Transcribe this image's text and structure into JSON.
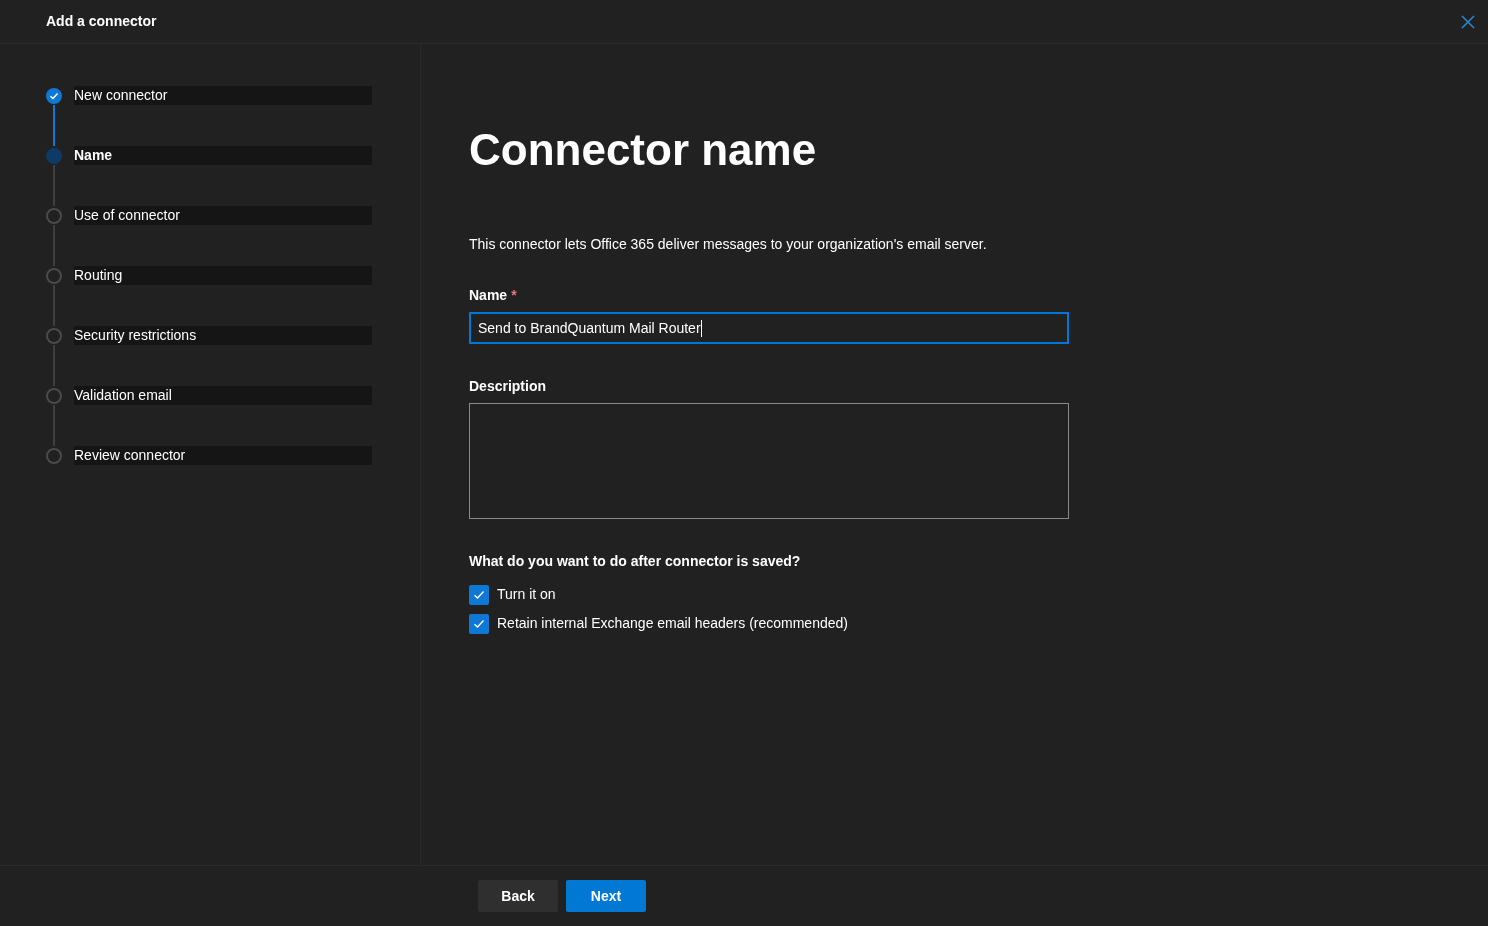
{
  "window": {
    "title": "Add a connector"
  },
  "steps": [
    {
      "label": "New connector",
      "completed": true,
      "selected": false
    },
    {
      "label": "Name",
      "completed": false,
      "selected": true
    },
    {
      "label": "Use of connector",
      "completed": false,
      "selected": false
    },
    {
      "label": "Routing",
      "completed": false,
      "selected": false
    },
    {
      "label": "Security restrictions",
      "completed": false,
      "selected": false
    },
    {
      "label": "Validation email",
      "completed": false,
      "selected": false
    },
    {
      "label": "Review connector",
      "completed": false,
      "selected": false
    }
  ],
  "page": {
    "heading": "Connector name",
    "intro": "This connector lets Office 365 deliver messages to your organization's email server.",
    "name_field": {
      "label": "Name",
      "required_mark": "*",
      "value": "Send to BrandQuantum Mail Router"
    },
    "description_field": {
      "label": "Description"
    },
    "options_heading": "What do you want to do after connector is saved?",
    "options": [
      {
        "label": "Turn it on",
        "checked": true
      },
      {
        "label": "Retain internal Exchange email headers (recommended)",
        "checked": true
      }
    ]
  },
  "buttons": [
    {
      "label": "Back",
      "kind": "secondary"
    },
    {
      "label": "Next",
      "kind": "primary"
    }
  ]
}
